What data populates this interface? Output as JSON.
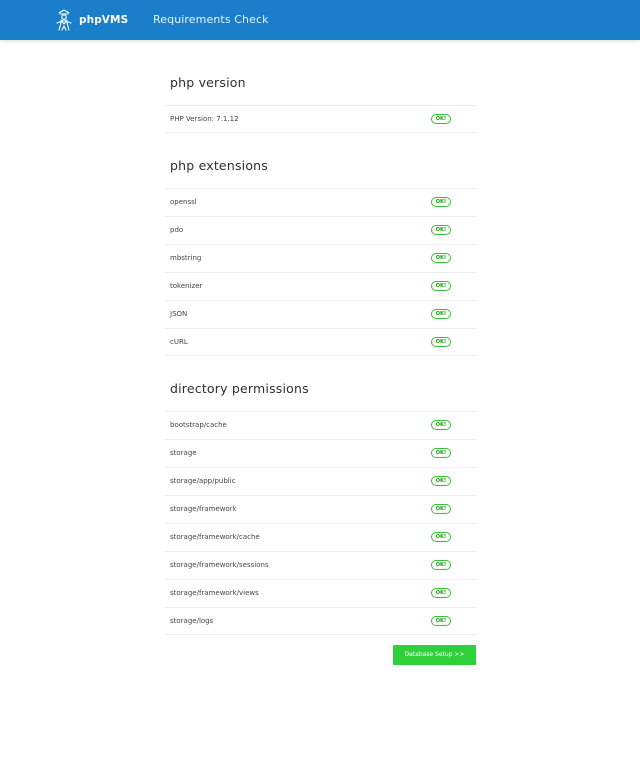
{
  "header": {
    "brand": "phpVMS",
    "page_title": "Requirements Check"
  },
  "sections": {
    "php_version": {
      "title": "php version",
      "rows": [
        {
          "label": "PHP Version: 7.1.12",
          "status": "OK!"
        }
      ]
    },
    "php_extensions": {
      "title": "php extensions",
      "rows": [
        {
          "label": "openssl",
          "status": "OK!"
        },
        {
          "label": "pdo",
          "status": "OK!"
        },
        {
          "label": "mbstring",
          "status": "OK!"
        },
        {
          "label": "tokenizer",
          "status": "OK!"
        },
        {
          "label": "JSON",
          "status": "OK!"
        },
        {
          "label": "cURL",
          "status": "OK!"
        }
      ]
    },
    "directory_permissions": {
      "title": "directory permissions",
      "rows": [
        {
          "label": "bootstrap/cache",
          "status": "OK!"
        },
        {
          "label": "storage",
          "status": "OK!"
        },
        {
          "label": "storage/app/public",
          "status": "OK!"
        },
        {
          "label": "storage/framework",
          "status": "OK!"
        },
        {
          "label": "storage/framework/cache",
          "status": "OK!"
        },
        {
          "label": "storage/framework/sessions",
          "status": "OK!"
        },
        {
          "label": "storage/framework/views",
          "status": "OK!"
        },
        {
          "label": "storage/logs",
          "status": "OK!"
        }
      ]
    }
  },
  "actions": {
    "next_label": "Database Setup >>"
  },
  "colors": {
    "header_bg": "#1a7ecb",
    "ok": "#1c9a1c",
    "button_bg": "#2fd03a"
  }
}
